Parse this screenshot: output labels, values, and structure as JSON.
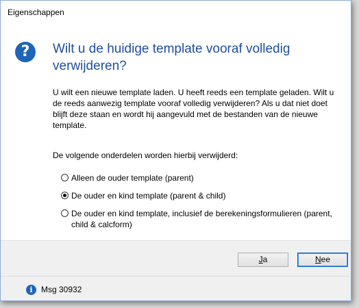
{
  "window": {
    "title": "Eigenschappen"
  },
  "icons": {
    "question": "?",
    "info": "i"
  },
  "dialog": {
    "heading": "Wilt u de huidige template vooraf volledig verwijderen?",
    "body": "U wilt een nieuwe template laden. U heeft reeds een template geladen. Wilt u de reeds aanwezig template vooraf volledig verwijderen? Als u dat niet doet blijft deze staan en wordt hij aangevuld met de bestanden van de nieuwe template.",
    "options_intro": "De volgende onderdelen worden hierbij verwijderd:",
    "options": [
      {
        "label": "Alleen de ouder template (parent)",
        "checked": false
      },
      {
        "label": "De ouder en kind template (parent & child)",
        "checked": true
      },
      {
        "label": "De ouder en kind template, inclusief de berekeningsformulieren (parent, child & calcform)",
        "checked": false
      }
    ]
  },
  "buttons": {
    "ja": {
      "underline": "J",
      "rest": "a"
    },
    "nee": {
      "underline": "N",
      "rest": "ee"
    }
  },
  "status": {
    "message": "Msg 30932"
  },
  "colors": {
    "accent": "#1e64b8",
    "heading": "#1e4f9c",
    "default_button_border": "#0a64c8"
  }
}
